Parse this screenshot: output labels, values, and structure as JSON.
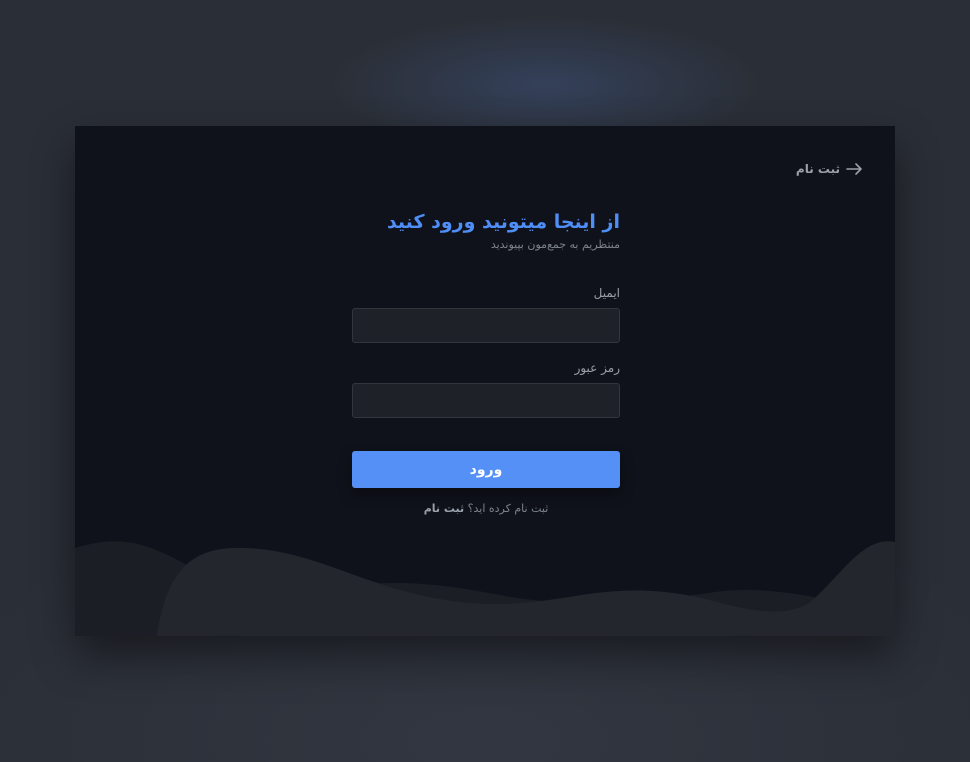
{
  "header": {
    "signup_link_label": "ثبت نام"
  },
  "login": {
    "title": "از اینجا میتونید ورود کنید",
    "subtitle": "منتظریم به جمع‌مون بپیوندید",
    "email_label": "ایمیل",
    "email_value": "",
    "password_label": "رمز عبور",
    "password_value": "",
    "submit_label": "ورود",
    "footer_prompt": "ثبت نام کرده اید؟",
    "footer_link_label": "ثبت نام"
  },
  "theme": {
    "accent": "#4f8ef7",
    "button": "#5590f6",
    "card_bg": "#0f121a",
    "page_bg": "#2a2e36"
  }
}
